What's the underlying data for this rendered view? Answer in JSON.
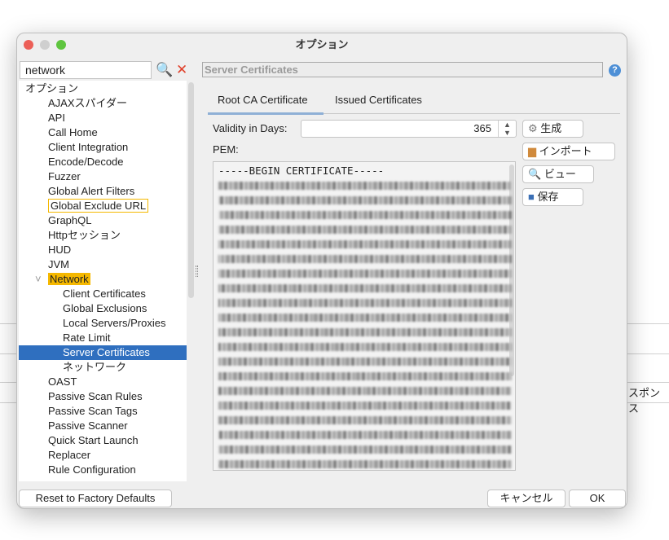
{
  "background": {
    "partial_text": "スポンス"
  },
  "window": {
    "title": "オプション"
  },
  "search": {
    "value": "network"
  },
  "tree": [
    {
      "label": "オプション",
      "level": 0,
      "expander": "˅"
    },
    {
      "label": "AJAXスパイダー",
      "level": 1
    },
    {
      "label": "API",
      "level": 1
    },
    {
      "label": "Call Home",
      "level": 1
    },
    {
      "label": "Client Integration",
      "level": 1
    },
    {
      "label": "Encode/Decode",
      "level": 1
    },
    {
      "label": "Fuzzer",
      "level": 1
    },
    {
      "label": "Global Alert Filters",
      "level": 1
    },
    {
      "label": "Global Exclude URL",
      "level": 1,
      "highlight": "outline"
    },
    {
      "label": "GraphQL",
      "level": 1
    },
    {
      "label": "Httpセッション",
      "level": 1
    },
    {
      "label": "HUD",
      "level": 1
    },
    {
      "label": "JVM",
      "level": 1
    },
    {
      "label": "Network",
      "level": 1,
      "highlight": "fill",
      "expander": "˅"
    },
    {
      "label": "Client Certificates",
      "level": 2
    },
    {
      "label": "Global Exclusions",
      "level": 2
    },
    {
      "label": "Local Servers/Proxies",
      "level": 2
    },
    {
      "label": "Rate Limit",
      "level": 2
    },
    {
      "label": "Server Certificates",
      "level": 2,
      "selected": true
    },
    {
      "label": "ネットワーク",
      "level": 2
    },
    {
      "label": "OAST",
      "level": 1
    },
    {
      "label": "Passive Scan Rules",
      "level": 1
    },
    {
      "label": "Passive Scan Tags",
      "level": 1
    },
    {
      "label": "Passive Scanner",
      "level": 1
    },
    {
      "label": "Quick Start Launch",
      "level": 1
    },
    {
      "label": "Replacer",
      "level": 1
    },
    {
      "label": "Rule Configuration",
      "level": 1
    }
  ],
  "panel": {
    "header": "Server Certificates",
    "help": "?",
    "tabs": [
      {
        "label": "Root CA Certificate",
        "active": true
      },
      {
        "label": "Issued Certificates",
        "active": false
      }
    ],
    "validity_label": "Validity in Days:",
    "validity_value": "365",
    "pem_label": "PEM:",
    "pem_first_line": "-----BEGIN CERTIFICATE-----",
    "buttons": {
      "generate": "生成",
      "import": "インポート",
      "view": "ビュー",
      "save": "保存"
    }
  },
  "footer": {
    "reset": "Reset to Factory Defaults",
    "cancel": "キャンセル",
    "ok": "OK"
  },
  "colors": {
    "selected": "#2f6fbf",
    "highlight": "#f5b800",
    "tab_underline": "#8fb0d6"
  }
}
